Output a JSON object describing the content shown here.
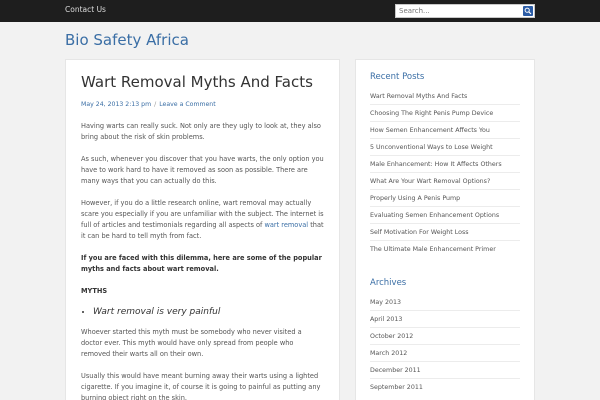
{
  "topbar": {
    "nav": [
      "Contact Us"
    ],
    "search_placeholder": "Search..."
  },
  "site": {
    "title": "Bio Safety Africa"
  },
  "post": {
    "title": "Wart Removal Myths And Facts",
    "date": "May 24, 2013 2:13 pm",
    "meta_sep": "/",
    "comment_link": "Leave a Comment",
    "p1": "Having warts can really suck. Not only are they ugly to look at, they also bring about the risk of skin problems.",
    "p2": "As such, whenever you discover that you have warts, the only option you have to work hard to have it removed as soon as possible. There are many ways that you can actually do this.",
    "p3_before": "However, if you do a little research online, wart removal may actually scare you especially if you are unfamiliar with the subject. The internet is full of articles and testimonials regarding all aspects of ",
    "p3_link": "wart removal",
    "p3_after": " that it can be hard to tell myth from fact.",
    "p4": "If you are faced with this dilemma, here are some of the popular myths and facts about wart removal.",
    "p5": "MYTHS",
    "bullet": "Wart removal is very painful",
    "p6": "Whoever started this myth must be somebody who never visited a doctor ever. This myth would have only spread from people who removed their warts all on their own.",
    "p7": "Usually this would have meant burning away their warts using a lighted cigarette. If you imagine it, of course it is going to painful as putting any burning object right on the skin."
  },
  "sidebar": {
    "recent_title": "Recent Posts",
    "recent": [
      "Wart Removal Myths And Facts",
      "Choosing The Right Penis Pump Device",
      "How Semen Enhancement Affects You",
      "5 Unconventional Ways to Lose Weight",
      "Male Enhancement: How It Affects Others",
      "What Are Your Wart Removal Options?",
      "Properly Using A Penis Pump",
      "Evaluating Semen Enhancement Options",
      "Self Motivation For Weight Loss",
      "The Ultimate Male Enhancement Primer"
    ],
    "archives_title": "Archives",
    "archives": [
      "May 2013",
      "April 2013",
      "October 2012",
      "March 2012",
      "December 2011",
      "September 2011"
    ]
  },
  "colors": {
    "topbar_bg": "#1e1e1e",
    "accent": "#3a6ea5",
    "page_bg": "#f2f2f2",
    "search_button": "#2b5ca6"
  }
}
